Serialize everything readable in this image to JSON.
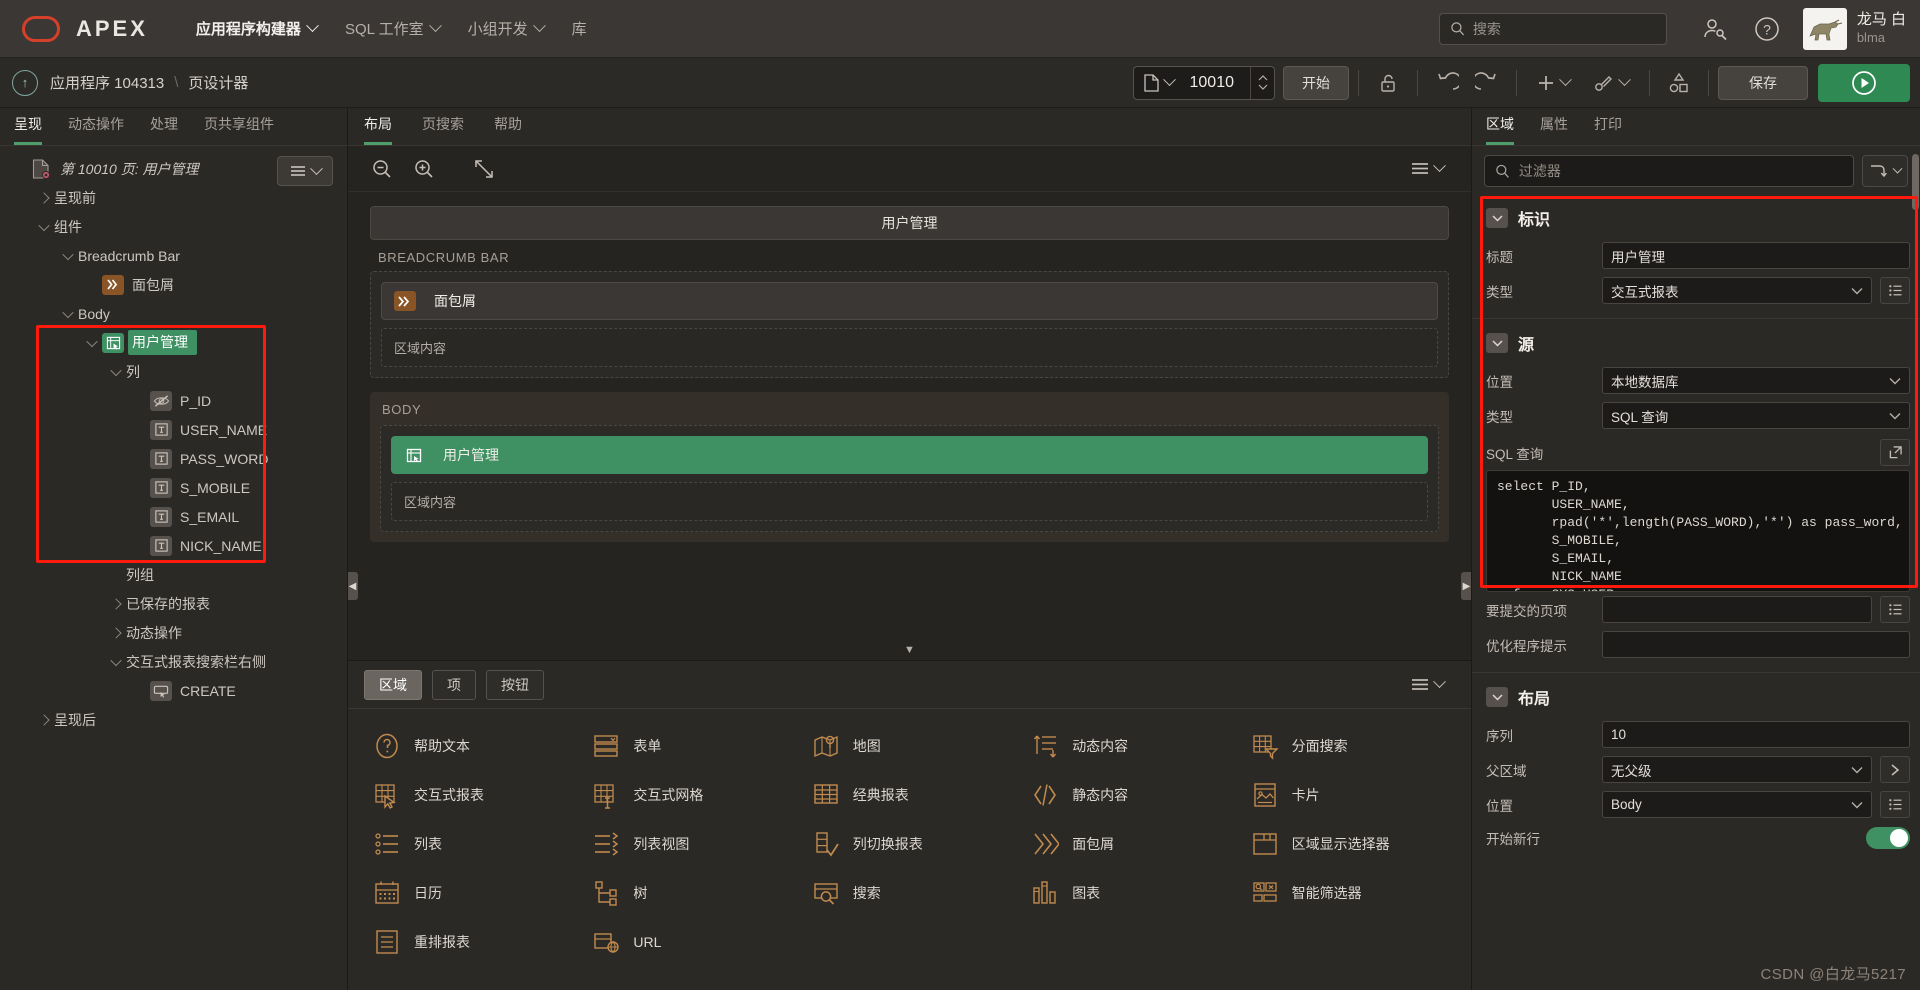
{
  "topnav": {
    "brand": "APEX",
    "logo_color": "#d4402a",
    "items": [
      {
        "label": "应用程序构建器",
        "caret": true,
        "active": true
      },
      {
        "label": "SQL 工作室",
        "caret": true,
        "active": false
      },
      {
        "label": "小组开发",
        "caret": true,
        "active": false
      },
      {
        "label": "库",
        "caret": false,
        "active": false
      }
    ],
    "search_placeholder": "搜索",
    "icons": [
      "user-settings-icon",
      "help-icon"
    ],
    "user": {
      "name": "龙马 白",
      "handle": "blma"
    }
  },
  "breadcrumb": {
    "up_label": "↑",
    "app": "应用程序 104313",
    "separator": "\\",
    "page": "页设计器",
    "page_number": "10010",
    "start_button": "开始",
    "save_button": "保存",
    "toolbar_icons": [
      "lock-icon",
      "undo-icon",
      "redo-icon",
      "add-icon",
      "utilities-icon",
      "shapes-icon"
    ],
    "run_icon": "play-icon"
  },
  "left": {
    "tabs": [
      {
        "label": "呈现",
        "active": true
      },
      {
        "label": "动态操作",
        "active": false
      },
      {
        "label": "处理",
        "active": false
      },
      {
        "label": "页共享组件",
        "active": false
      }
    ],
    "menu_icon": "hamburger-icon",
    "tree": [
      {
        "label": "第 10010 页: 用户管理",
        "indent": 0,
        "toggle": "none",
        "icon": "page-icon",
        "italic": true,
        "selected": false
      },
      {
        "label": "呈现前",
        "indent": 1,
        "toggle": "closed",
        "icon": "none",
        "italic": false,
        "selected": false
      },
      {
        "label": "组件",
        "indent": 1,
        "toggle": "open",
        "icon": "none",
        "italic": false,
        "selected": false
      },
      {
        "label": "Breadcrumb Bar",
        "indent": 2,
        "toggle": "open",
        "icon": "none",
        "italic": false,
        "selected": false
      },
      {
        "label": "面包屑",
        "indent": 3,
        "toggle": "none",
        "icon": "breadcrumb-icon",
        "italic": false,
        "selected": false
      },
      {
        "label": "Body",
        "indent": 2,
        "toggle": "open",
        "icon": "none",
        "italic": false,
        "selected": false
      },
      {
        "label": "用户管理",
        "indent": 3,
        "toggle": "open",
        "icon": "interactive-report-icon",
        "italic": false,
        "selected": true
      },
      {
        "label": "列",
        "indent": 4,
        "toggle": "open",
        "icon": "none",
        "italic": false,
        "selected": false
      },
      {
        "label": "P_ID",
        "indent": 5,
        "toggle": "none",
        "icon": "hidden-column-icon",
        "italic": false,
        "selected": false
      },
      {
        "label": "USER_NAME",
        "indent": 5,
        "toggle": "none",
        "icon": "text-column-icon",
        "italic": false,
        "selected": false
      },
      {
        "label": "PASS_WORD",
        "indent": 5,
        "toggle": "none",
        "icon": "text-column-icon",
        "italic": false,
        "selected": false
      },
      {
        "label": "S_MOBILE",
        "indent": 5,
        "toggle": "none",
        "icon": "text-column-icon",
        "italic": false,
        "selected": false
      },
      {
        "label": "S_EMAIL",
        "indent": 5,
        "toggle": "none",
        "icon": "text-column-icon",
        "italic": false,
        "selected": false
      },
      {
        "label": "NICK_NAME",
        "indent": 5,
        "toggle": "none",
        "icon": "text-column-icon",
        "italic": false,
        "selected": false
      },
      {
        "label": "列组",
        "indent": 4,
        "toggle": "none",
        "icon": "none",
        "italic": false,
        "selected": false
      },
      {
        "label": "已保存的报表",
        "indent": 4,
        "toggle": "closed",
        "icon": "none",
        "italic": false,
        "selected": false
      },
      {
        "label": "动态操作",
        "indent": 4,
        "toggle": "closed",
        "icon": "none",
        "italic": false,
        "selected": false
      },
      {
        "label": "交互式报表搜索栏右侧",
        "indent": 4,
        "toggle": "open",
        "icon": "none",
        "italic": false,
        "selected": false
      },
      {
        "label": "CREATE",
        "indent": 5,
        "toggle": "none",
        "icon": "button-icon",
        "italic": false,
        "selected": false
      },
      {
        "label": "呈现后",
        "indent": 1,
        "toggle": "closed",
        "icon": "none",
        "italic": false,
        "selected": false
      }
    ],
    "highlight_color": "#ff1a0d"
  },
  "center": {
    "tabs": [
      {
        "label": "布局",
        "active": true
      },
      {
        "label": "页搜索",
        "active": false
      },
      {
        "label": "帮助",
        "active": false
      }
    ],
    "toolbar_icons": [
      "zoom-out-icon",
      "zoom-in-icon",
      "expand-icon",
      "hamburger-icon"
    ],
    "canvas": {
      "page_title": "用户管理",
      "sections": [
        {
          "label": "BREADCRUMB BAR",
          "component": "面包屑",
          "component_icon": "breadcrumb-icon",
          "component_style": "brown",
          "body_text": "区域内容"
        },
        {
          "label": "BODY",
          "component": "用户管理",
          "component_icon": "interactive-report-icon",
          "component_style": "green",
          "body_text": "区域内容"
        }
      ]
    },
    "gallery": {
      "tabs": [
        {
          "label": "区域",
          "active": true
        },
        {
          "label": "项",
          "active": false
        },
        {
          "label": "按钮",
          "active": false
        }
      ],
      "menu_icon": "hamburger-icon",
      "items": [
        {
          "label": "帮助文本",
          "icon": "help-text-icon"
        },
        {
          "label": "表单",
          "icon": "form-icon"
        },
        {
          "label": "地图",
          "icon": "map-icon"
        },
        {
          "label": "动态内容",
          "icon": "dynamic-content-icon"
        },
        {
          "label": "分面搜索",
          "icon": "faceted-search-icon"
        },
        {
          "label": "交互式报表",
          "icon": "interactive-report-icon"
        },
        {
          "label": "交互式网格",
          "icon": "interactive-grid-icon"
        },
        {
          "label": "经典报表",
          "icon": "classic-report-icon"
        },
        {
          "label": "静态内容",
          "icon": "static-content-icon"
        },
        {
          "label": "卡片",
          "icon": "cards-icon"
        },
        {
          "label": "列表",
          "icon": "list-icon"
        },
        {
          "label": "列表视图",
          "icon": "list-view-icon"
        },
        {
          "label": "列切换报表",
          "icon": "column-toggle-icon"
        },
        {
          "label": "面包屑",
          "icon": "breadcrumb-icon"
        },
        {
          "label": "区域显示选择器",
          "icon": "region-display-selector-icon"
        },
        {
          "label": "日历",
          "icon": "calendar-icon"
        },
        {
          "label": "树",
          "icon": "tree-icon"
        },
        {
          "label": "搜索",
          "icon": "search-region-icon"
        },
        {
          "label": "图表",
          "icon": "chart-icon"
        },
        {
          "label": "智能筛选器",
          "icon": "smart-filter-icon"
        },
        {
          "label": "重排报表",
          "icon": "reflow-report-icon"
        },
        {
          "label": "URL",
          "icon": "url-icon"
        }
      ]
    }
  },
  "right": {
    "tabs": [
      {
        "label": "区域",
        "active": true
      },
      {
        "label": "属性",
        "active": false
      },
      {
        "label": "打印",
        "active": false
      }
    ],
    "filter_placeholder": "过滤器",
    "collapse_icon": "collapse-all-icon",
    "sections": [
      {
        "title": "标识",
        "rows": [
          {
            "label": "标题",
            "value": "用户管理",
            "kind": "text",
            "button": false
          },
          {
            "label": "类型",
            "value": "交互式报表",
            "kind": "select",
            "button": true
          }
        ]
      },
      {
        "title": "源",
        "rows": [
          {
            "label": "位置",
            "value": "本地数据库",
            "kind": "select",
            "button": false
          },
          {
            "label": "类型",
            "value": "SQL 查询",
            "kind": "select",
            "button": false
          }
        ],
        "code_label": "SQL 查询",
        "code_expand_icon": "expand-editor-icon",
        "code": "select P_ID,\n       USER_NAME,\n       rpad('*',length(PASS_WORD),'*') as pass_word,\n       S_MOBILE,\n       S_EMAIL,\n       NICK_NAME\n  from SYS_USER",
        "rows_after": [
          {
            "label": "要提交的页项",
            "value": "",
            "kind": "text",
            "button": true
          },
          {
            "label": "优化程序提示",
            "value": "",
            "kind": "text",
            "button": false
          }
        ]
      },
      {
        "title": "布局",
        "rows": [
          {
            "label": "序列",
            "value": "10",
            "kind": "text",
            "button": false
          },
          {
            "label": "父区域",
            "value": "无父级",
            "kind": "select",
            "button": "chevron"
          },
          {
            "label": "位置",
            "value": "Body",
            "kind": "select",
            "button": true
          }
        ],
        "toggle_row": {
          "label": "开始新行",
          "on": true
        }
      }
    ],
    "highlight_color": "#ff1a0d"
  },
  "watermark": "CSDN @白龙马5217"
}
